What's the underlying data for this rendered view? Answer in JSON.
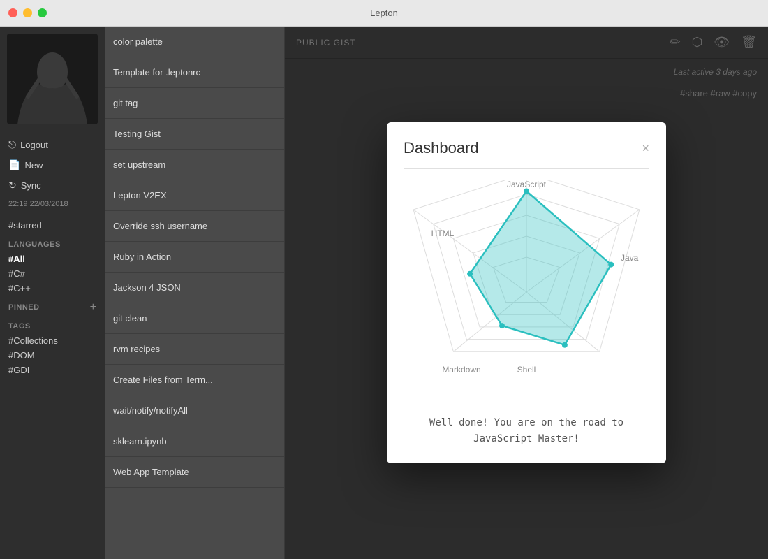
{
  "titlebar": {
    "title": "Lepton"
  },
  "sidebar": {
    "menu_items": [
      {
        "id": "logout",
        "label": "Logout",
        "icon": "⎋"
      },
      {
        "id": "new",
        "label": "New",
        "icon": "📄"
      },
      {
        "id": "sync",
        "label": "Sync",
        "icon": "↻"
      }
    ],
    "datetime": "22:19 22/03/2018",
    "starred_label": "#starred",
    "languages_title": "LANGUAGES",
    "languages": [
      {
        "id": "all",
        "label": "#All",
        "active": true
      },
      {
        "id": "csharp",
        "label": "#C#",
        "active": false
      },
      {
        "id": "cpp",
        "label": "#C++",
        "active": false
      }
    ],
    "pinned_title": "PINNED",
    "pinned_add": "+",
    "tags_title": "TAGS",
    "tags": [
      {
        "id": "collections",
        "label": "#Collections"
      },
      {
        "id": "dom",
        "label": "#DOM"
      },
      {
        "id": "gdi",
        "label": "#GDI"
      }
    ]
  },
  "list": {
    "items": [
      "color palette",
      "Template for .leptonrc",
      "git tag",
      "Testing Gist",
      "set upstream",
      "Lepton V2EX",
      "Override ssh username",
      "Ruby in Action",
      "Jackson 4 JSON",
      "git clean",
      "rvm recipes",
      "Create Files from Term...",
      "wait/notify/notifyAll",
      "sklearn.ipynb",
      "Web App Template"
    ]
  },
  "content": {
    "gist_label": "PUBLIC GIST",
    "last_active": "Last active 3 days ago",
    "share_tags": "#share  #raw  #copy",
    "action_icons": [
      "✏️",
      "⬡",
      "👁",
      "🗑"
    ]
  },
  "modal": {
    "title": "Dashboard",
    "close_label": "×",
    "radar": {
      "labels": [
        "JavaScript",
        "Java",
        "Shell",
        "Markdown",
        "HTML"
      ],
      "values": [
        0.85,
        0.75,
        0.55,
        0.35,
        0.5
      ],
      "accent_color": "#2abfbf"
    },
    "message": "Well done! You are on the road to\nJavaScript Master!"
  }
}
